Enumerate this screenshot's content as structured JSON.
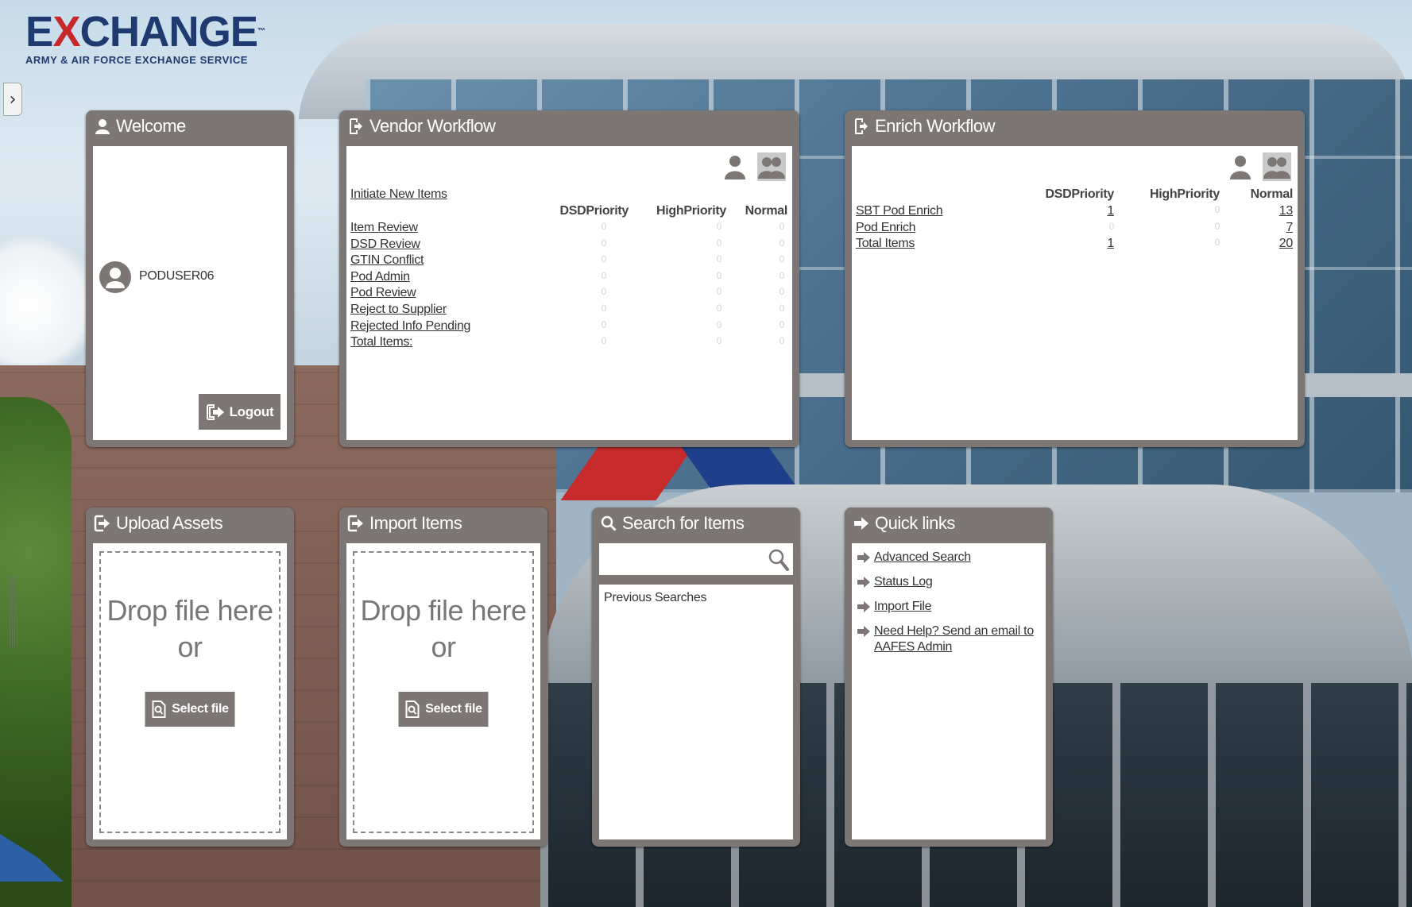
{
  "brand": {
    "word_pre": "E",
    "word_x": "X",
    "word_post": "CHANGE",
    "tm": "™",
    "subtitle": "ARMY & AIR FORCE EXCHANGE SERVICE"
  },
  "sidebar_toggle": {
    "glyph": "›",
    "icon": "chevron-right-icon"
  },
  "welcome": {
    "title": "Welcome",
    "icon": "user-icon",
    "username": "PODUSER06",
    "logout_label": "Logout"
  },
  "vendor_workflow": {
    "title": "Vendor Workflow",
    "icon": "workflow-icon",
    "initiate_link": "Initiate New Items",
    "columns": [
      "DSDPriority",
      "HighPriority",
      "Normal"
    ],
    "rows": [
      {
        "label": "Item Review",
        "values": [
          "0",
          "0",
          "0"
        ]
      },
      {
        "label": "DSD Review",
        "values": [
          "0",
          "0",
          "0"
        ]
      },
      {
        "label": "GTIN Conflict",
        "values": [
          "0",
          "0",
          "0"
        ]
      },
      {
        "label": "Pod Admin",
        "values": [
          "0",
          "0",
          "0"
        ]
      },
      {
        "label": "Pod Review",
        "values": [
          "0",
          "0",
          "0"
        ]
      },
      {
        "label": "Reject to Supplier",
        "values": [
          "0",
          "0",
          "0"
        ]
      },
      {
        "label": "Rejected Info Pending",
        "values": [
          "0",
          "0",
          "0"
        ]
      },
      {
        "label": "Total Items:",
        "values": [
          "0",
          "0",
          "0"
        ]
      }
    ]
  },
  "enrich_workflow": {
    "title": "Enrich Workflow",
    "icon": "workflow-icon",
    "columns": [
      "DSDPriority",
      "HighPriority",
      "Normal"
    ],
    "rows": [
      {
        "label": "SBT Pod Enrich",
        "values": [
          "1",
          "0",
          "13"
        ]
      },
      {
        "label": "Pod Enrich",
        "values": [
          "0",
          "0",
          "7"
        ]
      },
      {
        "label": "Total Items",
        "values": [
          "1",
          "0",
          "20"
        ]
      }
    ]
  },
  "upload_assets": {
    "title": "Upload Assets",
    "icon": "sign-in-icon",
    "drop_text_1": "Drop file here",
    "drop_text_2": "or",
    "select_label": "Select file"
  },
  "import_items": {
    "title": "Import Items",
    "icon": "sign-in-icon",
    "drop_text_1": "Drop file here",
    "drop_text_2": "or",
    "select_label": "Select file"
  },
  "search_items": {
    "title": "Search for Items",
    "icon": "search-icon",
    "query": "",
    "previous_title": "Previous Searches"
  },
  "quick_links": {
    "title": "Quick links",
    "icon": "arrow-right-icon",
    "items": [
      {
        "label": "Advanced Search"
      },
      {
        "label": "Status Log"
      },
      {
        "label": "Import File"
      },
      {
        "label": "Need Help? Send an email to AAFES Admin"
      }
    ]
  },
  "colors": {
    "widget_frame": "#7c7775",
    "brand_blue": "#1f3a6e",
    "brand_red": "#c8282c",
    "zero_value": "#d4d4d4"
  }
}
